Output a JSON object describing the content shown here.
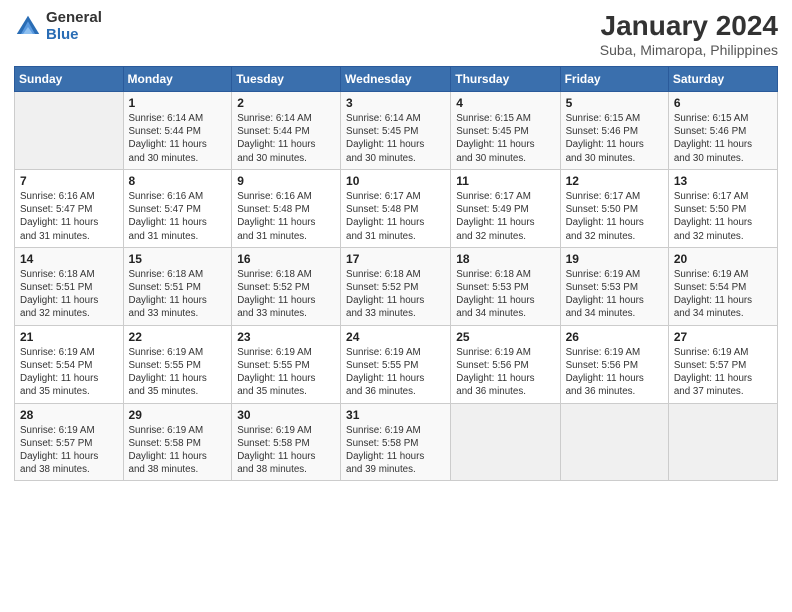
{
  "logo": {
    "general": "General",
    "blue": "Blue"
  },
  "title": "January 2024",
  "subtitle": "Suba, Mimaropa, Philippines",
  "days_of_week": [
    "Sunday",
    "Monday",
    "Tuesday",
    "Wednesday",
    "Thursday",
    "Friday",
    "Saturday"
  ],
  "weeks": [
    [
      {
        "day": "",
        "info": ""
      },
      {
        "day": "1",
        "info": "Sunrise: 6:14 AM\nSunset: 5:44 PM\nDaylight: 11 hours\nand 30 minutes."
      },
      {
        "day": "2",
        "info": "Sunrise: 6:14 AM\nSunset: 5:44 PM\nDaylight: 11 hours\nand 30 minutes."
      },
      {
        "day": "3",
        "info": "Sunrise: 6:14 AM\nSunset: 5:45 PM\nDaylight: 11 hours\nand 30 minutes."
      },
      {
        "day": "4",
        "info": "Sunrise: 6:15 AM\nSunset: 5:45 PM\nDaylight: 11 hours\nand 30 minutes."
      },
      {
        "day": "5",
        "info": "Sunrise: 6:15 AM\nSunset: 5:46 PM\nDaylight: 11 hours\nand 30 minutes."
      },
      {
        "day": "6",
        "info": "Sunrise: 6:15 AM\nSunset: 5:46 PM\nDaylight: 11 hours\nand 30 minutes."
      }
    ],
    [
      {
        "day": "7",
        "info": "Sunrise: 6:16 AM\nSunset: 5:47 PM\nDaylight: 11 hours\nand 31 minutes."
      },
      {
        "day": "8",
        "info": "Sunrise: 6:16 AM\nSunset: 5:47 PM\nDaylight: 11 hours\nand 31 minutes."
      },
      {
        "day": "9",
        "info": "Sunrise: 6:16 AM\nSunset: 5:48 PM\nDaylight: 11 hours\nand 31 minutes."
      },
      {
        "day": "10",
        "info": "Sunrise: 6:17 AM\nSunset: 5:48 PM\nDaylight: 11 hours\nand 31 minutes."
      },
      {
        "day": "11",
        "info": "Sunrise: 6:17 AM\nSunset: 5:49 PM\nDaylight: 11 hours\nand 32 minutes."
      },
      {
        "day": "12",
        "info": "Sunrise: 6:17 AM\nSunset: 5:50 PM\nDaylight: 11 hours\nand 32 minutes."
      },
      {
        "day": "13",
        "info": "Sunrise: 6:17 AM\nSunset: 5:50 PM\nDaylight: 11 hours\nand 32 minutes."
      }
    ],
    [
      {
        "day": "14",
        "info": "Sunrise: 6:18 AM\nSunset: 5:51 PM\nDaylight: 11 hours\nand 32 minutes."
      },
      {
        "day": "15",
        "info": "Sunrise: 6:18 AM\nSunset: 5:51 PM\nDaylight: 11 hours\nand 33 minutes."
      },
      {
        "day": "16",
        "info": "Sunrise: 6:18 AM\nSunset: 5:52 PM\nDaylight: 11 hours\nand 33 minutes."
      },
      {
        "day": "17",
        "info": "Sunrise: 6:18 AM\nSunset: 5:52 PM\nDaylight: 11 hours\nand 33 minutes."
      },
      {
        "day": "18",
        "info": "Sunrise: 6:18 AM\nSunset: 5:53 PM\nDaylight: 11 hours\nand 34 minutes."
      },
      {
        "day": "19",
        "info": "Sunrise: 6:19 AM\nSunset: 5:53 PM\nDaylight: 11 hours\nand 34 minutes."
      },
      {
        "day": "20",
        "info": "Sunrise: 6:19 AM\nSunset: 5:54 PM\nDaylight: 11 hours\nand 34 minutes."
      }
    ],
    [
      {
        "day": "21",
        "info": "Sunrise: 6:19 AM\nSunset: 5:54 PM\nDaylight: 11 hours\nand 35 minutes."
      },
      {
        "day": "22",
        "info": "Sunrise: 6:19 AM\nSunset: 5:55 PM\nDaylight: 11 hours\nand 35 minutes."
      },
      {
        "day": "23",
        "info": "Sunrise: 6:19 AM\nSunset: 5:55 PM\nDaylight: 11 hours\nand 35 minutes."
      },
      {
        "day": "24",
        "info": "Sunrise: 6:19 AM\nSunset: 5:55 PM\nDaylight: 11 hours\nand 36 minutes."
      },
      {
        "day": "25",
        "info": "Sunrise: 6:19 AM\nSunset: 5:56 PM\nDaylight: 11 hours\nand 36 minutes."
      },
      {
        "day": "26",
        "info": "Sunrise: 6:19 AM\nSunset: 5:56 PM\nDaylight: 11 hours\nand 36 minutes."
      },
      {
        "day": "27",
        "info": "Sunrise: 6:19 AM\nSunset: 5:57 PM\nDaylight: 11 hours\nand 37 minutes."
      }
    ],
    [
      {
        "day": "28",
        "info": "Sunrise: 6:19 AM\nSunset: 5:57 PM\nDaylight: 11 hours\nand 38 minutes."
      },
      {
        "day": "29",
        "info": "Sunrise: 6:19 AM\nSunset: 5:58 PM\nDaylight: 11 hours\nand 38 minutes."
      },
      {
        "day": "30",
        "info": "Sunrise: 6:19 AM\nSunset: 5:58 PM\nDaylight: 11 hours\nand 38 minutes."
      },
      {
        "day": "31",
        "info": "Sunrise: 6:19 AM\nSunset: 5:58 PM\nDaylight: 11 hours\nand 39 minutes."
      },
      {
        "day": "",
        "info": ""
      },
      {
        "day": "",
        "info": ""
      },
      {
        "day": "",
        "info": ""
      }
    ]
  ]
}
